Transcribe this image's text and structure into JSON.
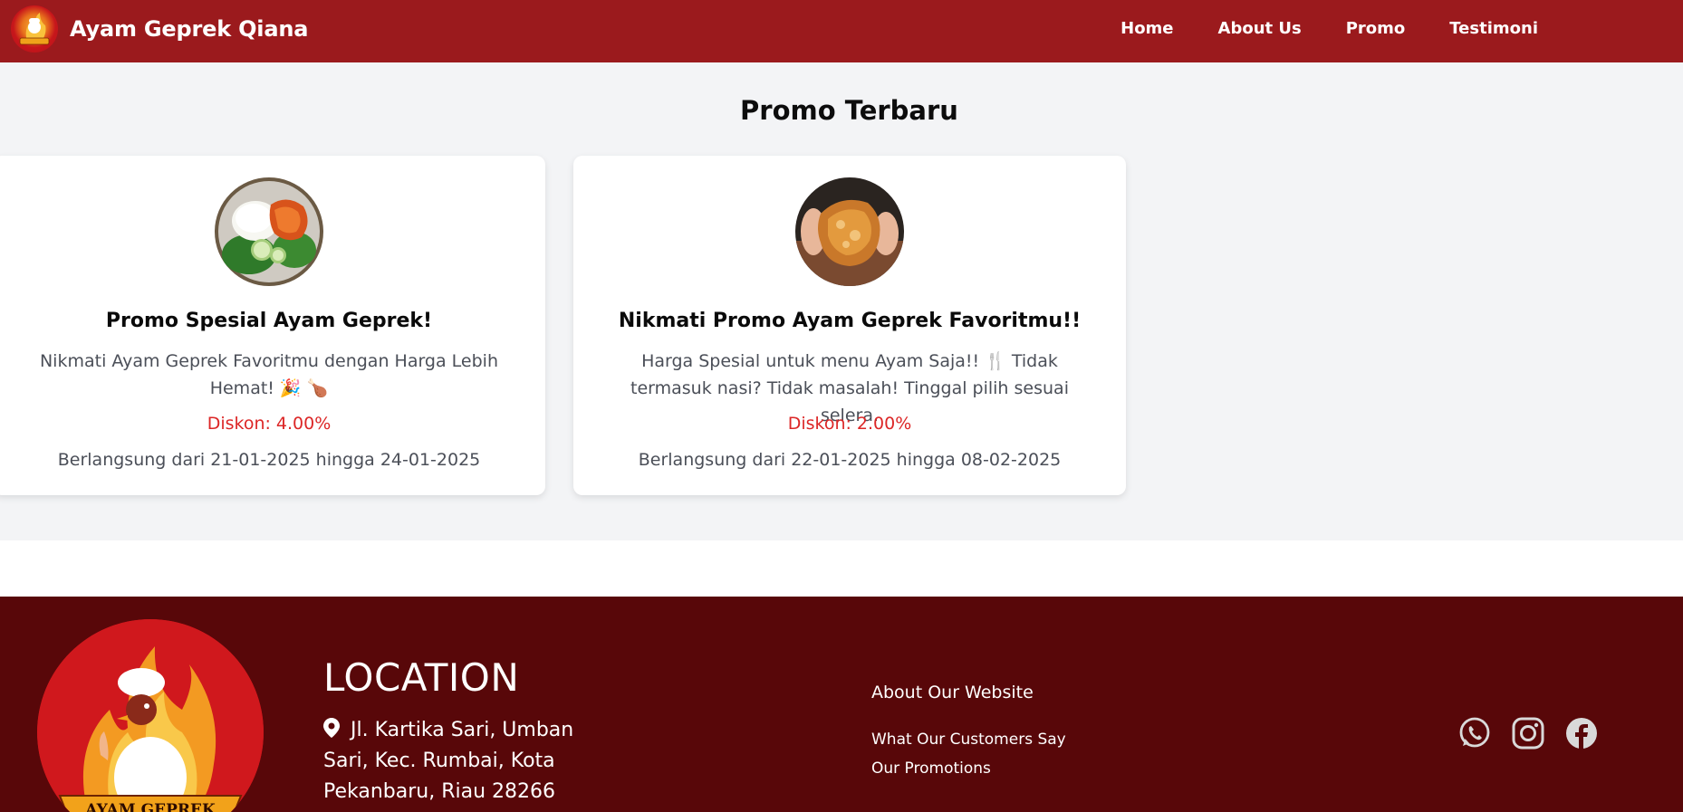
{
  "nav": {
    "brand": "Ayam Geprek Qiana",
    "links": [
      "Home",
      "About Us",
      "Promo",
      "Testimoni"
    ]
  },
  "promo": {
    "title": "Promo Terbaru",
    "cards": [
      {
        "image": "rice-and-fried-chicken-plate",
        "title": "Promo Spesial Ayam Geprek!",
        "description": "Nikmati Ayam Geprek Favoritmu dengan Harga Lebih Hemat! 🎉 🍗",
        "discount": "Diskon: 4.00%",
        "period": "Berlangsung dari 21-01-2025 hingga 24-01-2025"
      },
      {
        "image": "fried-chicken-in-hands",
        "title": "Nikmati Promo Ayam Geprek Favoritmu!!",
        "description": "Harga Spesial untuk menu Ayam Saja!! 🍴 Tidak termasuk nasi? Tidak masalah! Tinggal pilih sesuai selera.",
        "discount": "Diskon: 2.00%",
        "period": "Berlangsung dari 22-01-2025 hingga 08-02-2025"
      }
    ]
  },
  "footer": {
    "logo_text": "AYAM GEPREK \"QIANA\"",
    "location_title": "LOCATION",
    "address": "Jl. Kartika Sari, Umban Sari, Kec. Rumbai, Kota Pekanbaru, Riau 28266",
    "about_title": "About Our Website",
    "links": [
      "What Our Customers Say",
      "Our Promotions"
    ],
    "socials": [
      "whatsapp-icon",
      "instagram-icon",
      "facebook-icon"
    ]
  },
  "colors": {
    "nav_bg": "#9b1a1d",
    "footer_bg": "#580709",
    "discount": "#dc2626",
    "section_bg": "#f3f4f6"
  }
}
